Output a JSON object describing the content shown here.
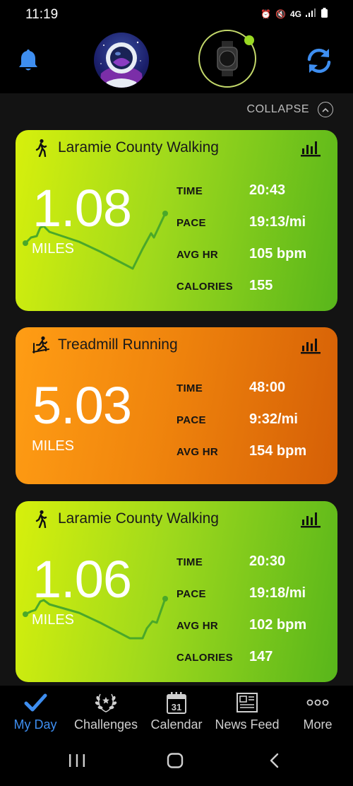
{
  "status_bar": {
    "time": "11:19",
    "network": "4G"
  },
  "header": {
    "bell_icon": "bell-icon",
    "sync_icon": "sync-icon"
  },
  "collapse": {
    "label": "COLLAPSE"
  },
  "cards": [
    {
      "title": "Laramie County Walking",
      "activity_icon": "walking-icon",
      "distance": "1.08",
      "unit": "MILES",
      "color": "#9fd91c",
      "stats": [
        {
          "label": "TIME",
          "value": "20:43"
        },
        {
          "label": "PACE",
          "value": "19:13/mi"
        },
        {
          "label": "AVG HR",
          "value": "105 bpm"
        },
        {
          "label": "CALORIES",
          "value": "155"
        }
      ]
    },
    {
      "title": "Treadmill Running",
      "activity_icon": "treadmill-icon",
      "distance": "5.03",
      "unit": "MILES",
      "color": "#f0850d",
      "stats": [
        {
          "label": "TIME",
          "value": "48:00"
        },
        {
          "label": "PACE",
          "value": "9:32/mi"
        },
        {
          "label": "AVG HR",
          "value": "154 bpm"
        }
      ]
    },
    {
      "title": "Laramie County Walking",
      "activity_icon": "walking-icon",
      "distance": "1.06",
      "unit": "MILES",
      "color": "#9fd91c",
      "stats": [
        {
          "label": "TIME",
          "value": "20:30"
        },
        {
          "label": "PACE",
          "value": "19:18/mi"
        },
        {
          "label": "AVG HR",
          "value": "102 bpm"
        },
        {
          "label": "CALORIES",
          "value": "147"
        }
      ]
    }
  ],
  "bottom_nav": [
    {
      "label": "My Day",
      "icon": "checkmark-icon",
      "active": true
    },
    {
      "label": "Challenges",
      "icon": "laurel-icon",
      "active": false
    },
    {
      "label": "Calendar",
      "icon": "calendar-icon",
      "active": false,
      "icon_text": "31"
    },
    {
      "label": "News Feed",
      "icon": "newspaper-icon",
      "active": false
    },
    {
      "label": "More",
      "icon": "more-icon",
      "active": false
    }
  ],
  "colors": {
    "accent": "#3e8ef0",
    "walk_green": "#9fd91c",
    "run_orange": "#f0850d",
    "trend_line": "#4aa82a"
  }
}
